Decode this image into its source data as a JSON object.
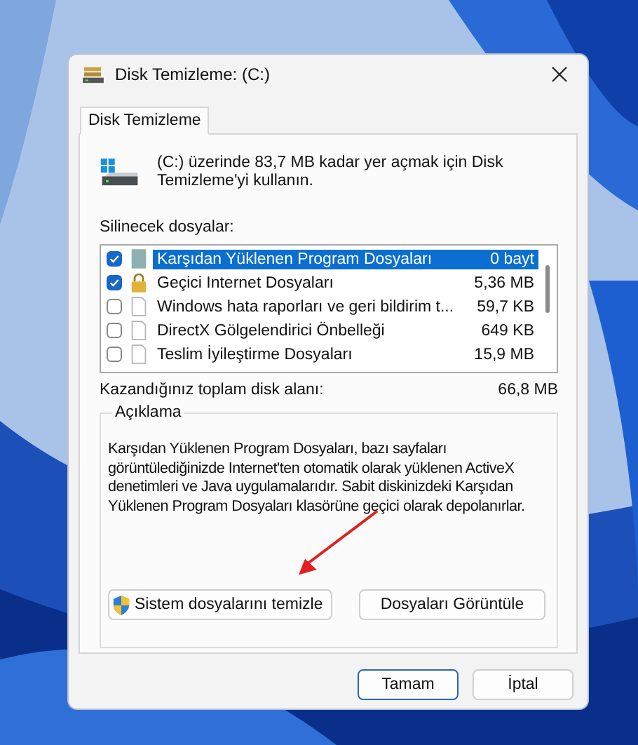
{
  "window": {
    "title": "Disk Temizleme:  (C:)"
  },
  "tabs": [
    {
      "label": "Disk Temizleme",
      "selected": true
    }
  ],
  "intro": "(C:) üzerinde 83,7 MB kadar yer açmak için Disk Temizleme'yi kullanın.",
  "files_label": "Silinecek dosyalar:",
  "files": [
    {
      "kind": "package",
      "name": "Karşıdan Yüklenen Program Dosyaları",
      "size": "0 bayt",
      "checked": true,
      "selected": true
    },
    {
      "kind": "lock",
      "name": "Geçici Internet Dosyaları",
      "size": "5,36 MB",
      "checked": true,
      "selected": false
    },
    {
      "kind": "file",
      "name": "Windows hata raporları ve geri bildirim t...",
      "size": "59,7 KB",
      "checked": false,
      "selected": false
    },
    {
      "kind": "file",
      "name": "DirectX Gölgelendirici Önbelleği",
      "size": "649 KB",
      "checked": false,
      "selected": false
    },
    {
      "kind": "file",
      "name": "Teslim İyileştirme Dosyaları",
      "size": "15,9 MB",
      "checked": false,
      "selected": false
    }
  ],
  "total": {
    "label": "Kazandığınız toplam disk alanı:",
    "value": "66,8 MB"
  },
  "description": {
    "title": "Açıklama",
    "text": "Karşıdan Yüklenen Program Dosyaları, bazı sayfaları görüntülediğinizde Internet'ten otomatik olarak yüklenen ActiveX denetimleri ve Java uygulamalarıdır. Sabit diskinizdeki Karşıdan Yüklenen Program Dosyaları klasörüne geçici olarak depolanırlar."
  },
  "actions": [
    {
      "kind": "shield",
      "label": "Sistem dosyalarını temizle"
    },
    {
      "kind": "plain",
      "label": "Dosyaları Görüntüle"
    }
  ],
  "buttons": [
    {
      "label": "Tamam",
      "default": true
    },
    {
      "label": "İptal",
      "default": false
    }
  ]
}
